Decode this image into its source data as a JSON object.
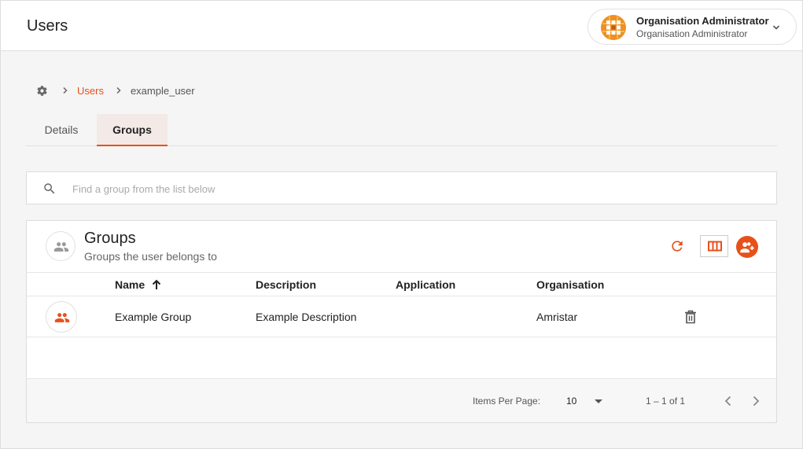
{
  "header": {
    "title": "Users",
    "user": {
      "name": "Organisation Administrator",
      "role": "Organisation Administrator"
    }
  },
  "breadcrumb": {
    "link": "Users",
    "current": "example_user"
  },
  "tabs": [
    {
      "label": "Details",
      "active": false
    },
    {
      "label": "Groups",
      "active": true
    }
  ],
  "search": {
    "placeholder": "Find a group from the list below",
    "value": ""
  },
  "card": {
    "title": "Groups",
    "subtitle": "Groups the user belongs to",
    "columns": [
      "Name",
      "Description",
      "Application",
      "Organisation"
    ],
    "sort": {
      "column": "Name",
      "direction": "ascending"
    },
    "rows": [
      {
        "name": "Example Group",
        "description": "Example Description",
        "application": "",
        "organisation": "Amristar"
      }
    ]
  },
  "pagination": {
    "items_per_page_label": "Items Per Page:",
    "items_per_page": "10",
    "range": "1 – 1 of 1"
  },
  "icons": {
    "breadcrumb_root": "gear-icon",
    "refresh": "refresh-icon",
    "columns": "view-columns-icon",
    "add": "add-group-icon",
    "delete": "trash-icon"
  },
  "colors": {
    "accent": "#e8501a",
    "tab_active_bg": "#f3e9e6",
    "logo": "#f0901e"
  }
}
